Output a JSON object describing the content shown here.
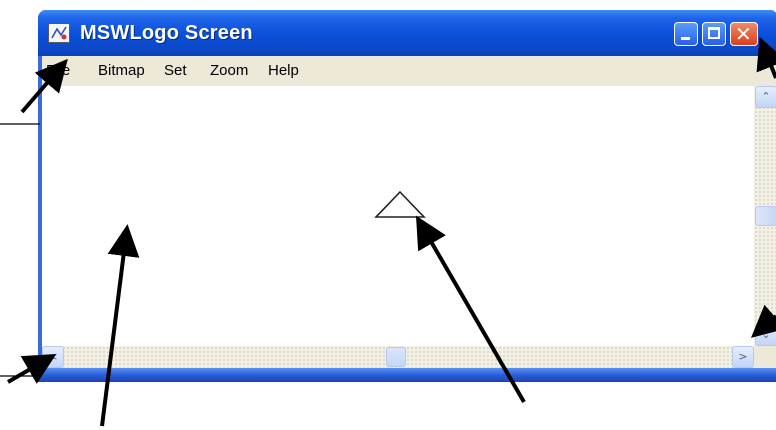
{
  "window": {
    "title": "MSWLogo Screen",
    "icons": {
      "app": "mswlogo-app-icon",
      "minimize": "minimize-icon",
      "maximize": "maximize-icon",
      "close": "close-icon",
      "close_glyph": "✕"
    }
  },
  "menubar": {
    "items": [
      {
        "label": "File"
      },
      {
        "label": "Bitmap"
      },
      {
        "label": "Set"
      },
      {
        "label": "Zoom"
      },
      {
        "label": "Help"
      }
    ]
  },
  "scrollbars": {
    "up_glyph": "⌃",
    "down_glyph": "⌄",
    "left_glyph": "<",
    "right_glyph": ">"
  },
  "colors": {
    "titlebar": "#0a4fd9",
    "menubar": "#ece9d8",
    "close_button": "#d8401c",
    "canvas": "#ffffff"
  }
}
